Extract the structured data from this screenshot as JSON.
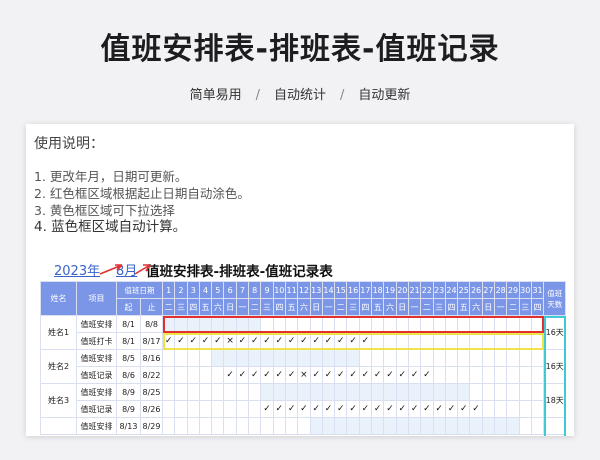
{
  "header": {
    "title": "值班安排表-排班表-值班记录",
    "tags": [
      "简单易用",
      "自动统计",
      "自动更新"
    ],
    "separator": "/"
  },
  "instructions": {
    "heading": "使用说明：",
    "lines": [
      "1. 更改年月，日期可更新。",
      "2. 红色框区域根据起止日期自动涂色。",
      "3. 黄色框区域可下拉选择",
      "4. 蓝色框区域自动计算。"
    ]
  },
  "sheet": {
    "year": "2023年",
    "month": "8月",
    "title": "值班安排表-排班表-值班记录表",
    "col_name": "姓名",
    "col_item": "项目",
    "col_dates": "值班日期",
    "col_start": "起",
    "col_end": "止",
    "col_days_a": "值班",
    "col_days_b": "天数",
    "days": [
      "1",
      "2",
      "3",
      "4",
      "5",
      "6",
      "7",
      "8",
      "9",
      "10",
      "11",
      "12",
      "13",
      "14",
      "15",
      "16",
      "17",
      "18",
      "19",
      "20",
      "21",
      "22",
      "23",
      "24",
      "25",
      "26",
      "27",
      "28",
      "29",
      "30",
      "31"
    ],
    "weekdays": [
      "二",
      "三",
      "四",
      "五",
      "六",
      "日",
      "一",
      "二",
      "三",
      "四",
      "五",
      "六",
      "日",
      "一",
      "二",
      "三",
      "四",
      "五",
      "六",
      "日",
      "一",
      "二",
      "三",
      "四",
      "五",
      "六",
      "日",
      "一",
      "二",
      "三",
      "四"
    ],
    "persons": [
      {
        "name": "姓名1",
        "days_total": "16天",
        "rows": [
          {
            "item": "值班安排",
            "start": "8/1",
            "end": "8/8",
            "shade": [
              1,
              8
            ],
            "marks": ""
          },
          {
            "item": "值班打卡",
            "start": "8/1",
            "end": "8/17",
            "shade": [
              0,
              0
            ],
            "marks": "✓✓✓✓✓×✓✓✓✓✓✓✓✓✓✓✓"
          }
        ]
      },
      {
        "name": "姓名2",
        "days_total": "16天",
        "rows": [
          {
            "item": "值班安排",
            "start": "8/5",
            "end": "8/16",
            "shade": [
              5,
              16
            ],
            "marks": ""
          },
          {
            "item": "值班记录",
            "start": "8/6",
            "end": "8/22",
            "shade": [
              0,
              0
            ],
            "marks": "     ✓✓✓✓✓✓×✓✓✓✓✓✓✓✓✓✓"
          }
        ]
      },
      {
        "name": "姓名3",
        "days_total": "18天",
        "rows": [
          {
            "item": "值班安排",
            "start": "8/9",
            "end": "8/25",
            "shade": [
              9,
              25
            ],
            "marks": ""
          },
          {
            "item": "值班记录",
            "start": "8/9",
            "end": "8/26",
            "shade": [
              0,
              0
            ],
            "marks": "        ✓✓✓✓✓✓✓✓✓✓✓✓✓✓✓✓✓✓"
          }
        ]
      },
      {
        "name": "",
        "days_total": "",
        "rows": [
          {
            "item": "值班安排",
            "start": "8/13",
            "end": "8/29",
            "shade": [
              13,
              29
            ],
            "marks": ""
          }
        ]
      }
    ]
  },
  "colors": {
    "red_box": "#e03030",
    "yellow_box": "#f2e24a",
    "blue_box": "#3fc9d6",
    "header": "#7b96e6",
    "shade": "#e9f1fb"
  }
}
